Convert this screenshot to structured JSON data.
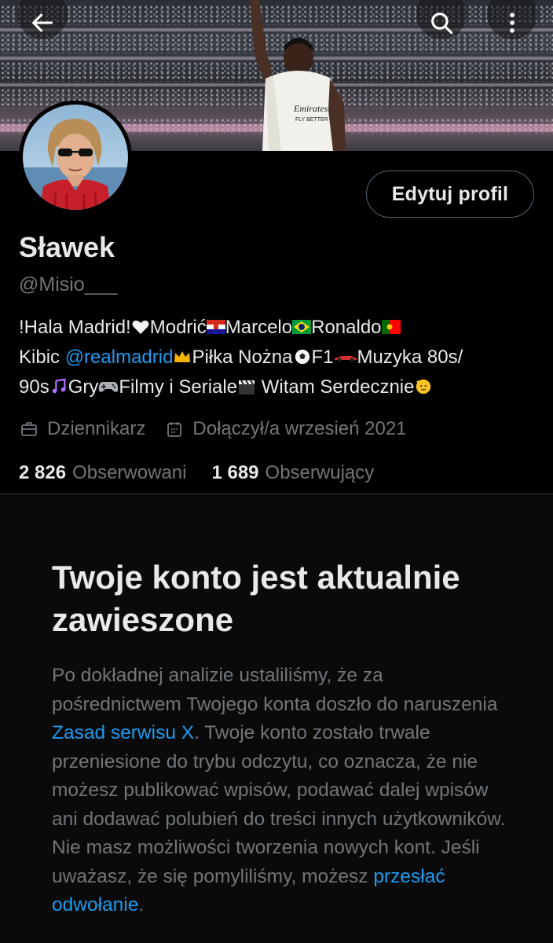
{
  "header": {
    "back_icon": "arrow-left-icon",
    "search_icon": "search-icon",
    "more_icon": "more-vertical-icon"
  },
  "profile": {
    "edit_label": "Edytuj profil",
    "name": "Sławek",
    "handle": "@Misio___",
    "bio": {
      "line1_a": "!Hala Madrid!",
      "line1_b": "Modrić",
      "line1_c": "Marcelo",
      "line1_d": "Ronaldo",
      "line2_a": "Kibic ",
      "line2_link": "@realmadrid",
      "line2_b": "Piłka Nożna",
      "line2_c": "F1",
      "line2_d": "Muzyka 80s/",
      "line3_a": "90s",
      "line3_b": "Gry",
      "line3_c": "Filmy i Seriale",
      "line3_d": " Witam Serdecznie"
    },
    "profession": "Dziennikarz",
    "joined": "Dołączył/a wrzesień 2021",
    "following_count": "2 826",
    "following_label": "Obserwowani",
    "followers_count": "1 689",
    "followers_label": "Obserwujący"
  },
  "suspension": {
    "title": "Twoje konto jest aktualnie zawieszone",
    "body_1": "Po dokładnej analizie ustaliliśmy, że za pośrednictwem Twojego konta doszło do naruszenia ",
    "rules_link": "Zasad serwisu X",
    "body_2": ". Twoje konto zostało trwale przeniesione do trybu odczytu, co oznacza, że nie możesz publikować wpisów, podawać dalej wpisów ani dodawać polubień do treści innych użytkowników. Nie masz możliwości tworzenia nowych kont. Jeśli uważasz, że się pomyliliśmy, możesz ",
    "appeal_link": "przesłać odwołanie",
    "body_3": "."
  },
  "colors": {
    "accent": "#1d9bf0",
    "secondary_text": "#71767b",
    "primary_text": "#e7e9ea",
    "background": "#000000"
  }
}
